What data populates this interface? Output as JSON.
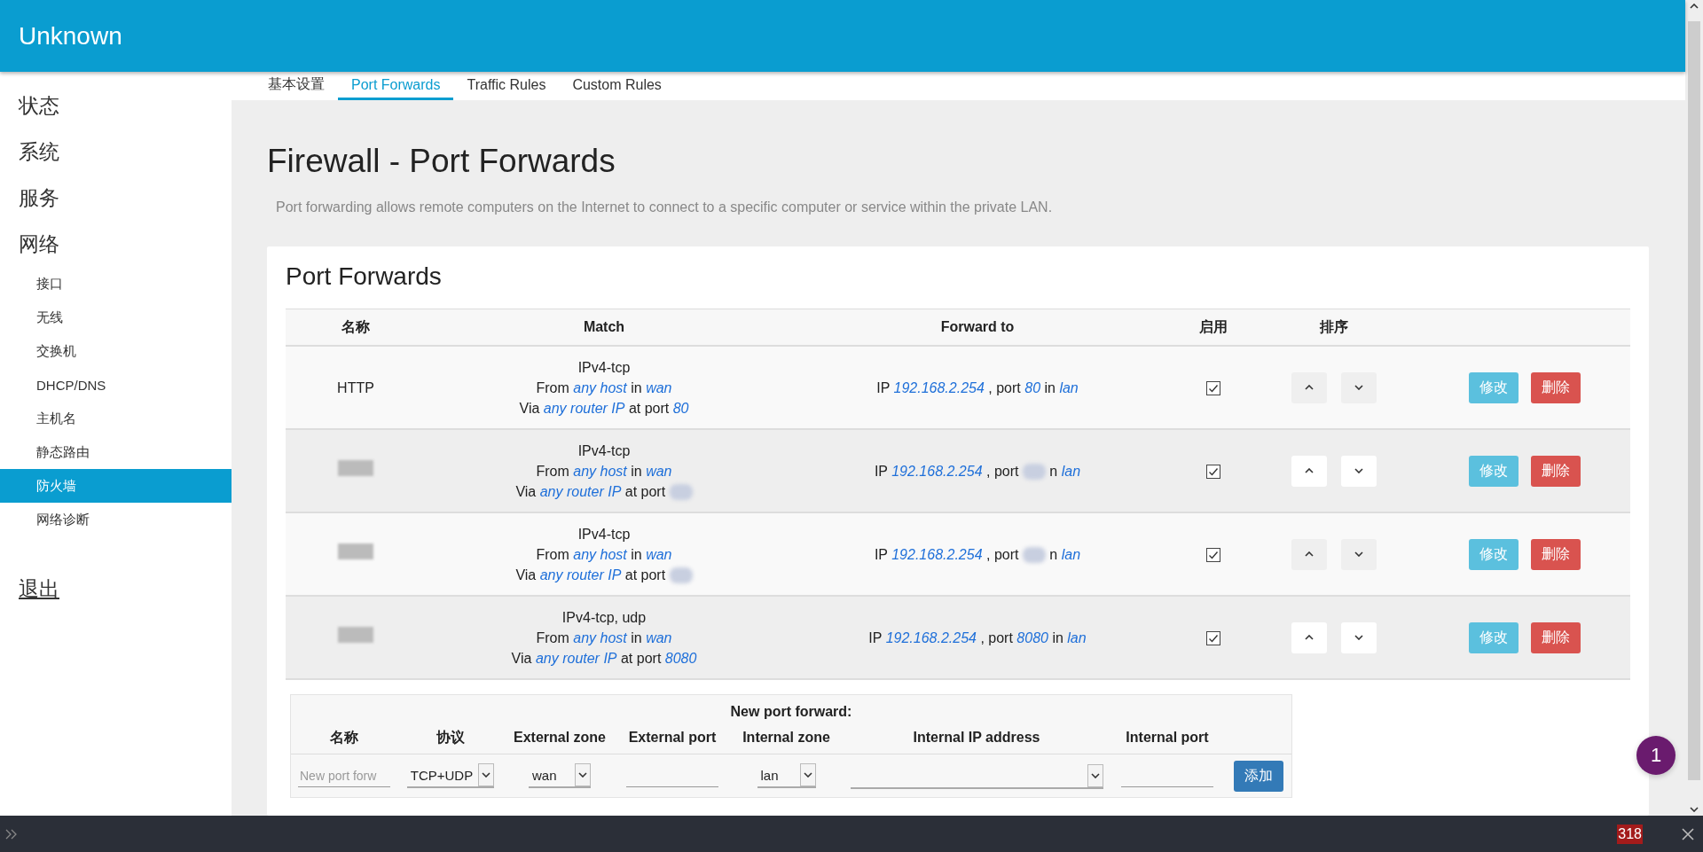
{
  "header": {
    "title": "Unknown"
  },
  "sidebar": {
    "items": [
      {
        "label": "状态",
        "selected": false
      },
      {
        "label": "系统",
        "selected": false
      },
      {
        "label": "服务",
        "selected": false
      },
      {
        "label": "网络",
        "selected": false,
        "children": [
          {
            "label": "接口",
            "selected": false
          },
          {
            "label": "无线",
            "selected": false
          },
          {
            "label": "交换机",
            "selected": false
          },
          {
            "label": "DHCP/DNS",
            "selected": false
          },
          {
            "label": "主机名",
            "selected": false
          },
          {
            "label": "静态路由",
            "selected": false
          },
          {
            "label": "防火墙",
            "selected": true
          },
          {
            "label": "网络诊断",
            "selected": false
          }
        ]
      }
    ],
    "logout": "退出"
  },
  "tabs": [
    {
      "label": "基本设置",
      "selected": false
    },
    {
      "label": "Port Forwards",
      "selected": true
    },
    {
      "label": "Traffic Rules",
      "selected": false
    },
    {
      "label": "Custom Rules",
      "selected": false
    }
  ],
  "page": {
    "title": "Firewall - Port Forwards",
    "description": "Port forwarding allows remote computers on the Internet to connect to a specific computer or service within the private LAN."
  },
  "section": {
    "title": "Port Forwards",
    "columns": [
      "名称",
      "Match",
      "Forward to",
      "启用",
      "排序"
    ],
    "rows": [
      {
        "name": {
          "kind": "text",
          "text": "HTTP"
        },
        "match": [
          [
            {
              "kind": "text",
              "text": "IPv4-tcp"
            }
          ],
          [
            {
              "kind": "text",
              "text": "From"
            },
            {
              "kind": "link",
              "text": "any host"
            },
            {
              "kind": "text",
              "text": "in"
            },
            {
              "kind": "link",
              "text": "wan"
            }
          ],
          [
            {
              "kind": "text",
              "text": "Via"
            },
            {
              "kind": "link",
              "text": "any router IP"
            },
            {
              "kind": "text",
              "text": "at port"
            },
            {
              "kind": "link",
              "text": "80"
            }
          ]
        ],
        "forward": [
          {
            "kind": "text",
            "text": "IP"
          },
          {
            "kind": "link",
            "text": "192.168.2.254"
          },
          {
            "kind": "text",
            "text": ", port"
          },
          {
            "kind": "link",
            "text": "80"
          },
          {
            "kind": "text",
            "text": "in"
          },
          {
            "kind": "link",
            "text": "lan"
          }
        ],
        "enabled": true,
        "edit": "修改",
        "delete": "删除"
      },
      {
        "name": {
          "kind": "redacted"
        },
        "match": [
          [
            {
              "kind": "text",
              "text": "IPv4-tcp"
            }
          ],
          [
            {
              "kind": "text",
              "text": "From"
            },
            {
              "kind": "link",
              "text": "any host"
            },
            {
              "kind": "text",
              "text": "in"
            },
            {
              "kind": "link",
              "text": "wan"
            }
          ],
          [
            {
              "kind": "text",
              "text": "Via"
            },
            {
              "kind": "link",
              "text": "any router IP"
            },
            {
              "kind": "text",
              "text": "at port"
            },
            {
              "kind": "redacted"
            }
          ]
        ],
        "forward": [
          {
            "kind": "text",
            "text": "IP"
          },
          {
            "kind": "link",
            "text": "192.168.2.254"
          },
          {
            "kind": "text",
            "text": ", port"
          },
          {
            "kind": "redacted"
          },
          {
            "kind": "text",
            "text": "n"
          },
          {
            "kind": "link",
            "text": "lan"
          }
        ],
        "enabled": true,
        "edit": "修改",
        "delete": "删除"
      },
      {
        "name": {
          "kind": "redacted"
        },
        "match": [
          [
            {
              "kind": "text",
              "text": "IPv4-tcp"
            }
          ],
          [
            {
              "kind": "text",
              "text": "From"
            },
            {
              "kind": "link",
              "text": "any host"
            },
            {
              "kind": "text",
              "text": "in"
            },
            {
              "kind": "link",
              "text": "wan"
            }
          ],
          [
            {
              "kind": "text",
              "text": "Via"
            },
            {
              "kind": "link",
              "text": "any router IP"
            },
            {
              "kind": "text",
              "text": "at port"
            },
            {
              "kind": "redacted"
            }
          ]
        ],
        "forward": [
          {
            "kind": "text",
            "text": "IP"
          },
          {
            "kind": "link",
            "text": "192.168.2.254"
          },
          {
            "kind": "text",
            "text": ", port"
          },
          {
            "kind": "redacted"
          },
          {
            "kind": "text",
            "text": "n"
          },
          {
            "kind": "link",
            "text": "lan"
          }
        ],
        "enabled": true,
        "edit": "修改",
        "delete": "删除"
      },
      {
        "name": {
          "kind": "redacted"
        },
        "match": [
          [
            {
              "kind": "text",
              "text": "IPv4-tcp, udp"
            }
          ],
          [
            {
              "kind": "text",
              "text": "From"
            },
            {
              "kind": "link",
              "text": "any host"
            },
            {
              "kind": "text",
              "text": "in"
            },
            {
              "kind": "link",
              "text": "wan"
            }
          ],
          [
            {
              "kind": "text",
              "text": "Via"
            },
            {
              "kind": "link",
              "text": "any router IP"
            },
            {
              "kind": "text",
              "text": "at port"
            },
            {
              "kind": "link",
              "text": "8080"
            }
          ]
        ],
        "forward": [
          {
            "kind": "text",
            "text": "IP"
          },
          {
            "kind": "link",
            "text": "192.168.2.254"
          },
          {
            "kind": "text",
            "text": ", port"
          },
          {
            "kind": "link",
            "text": "8080"
          },
          {
            "kind": "text",
            "text": "in"
          },
          {
            "kind": "link",
            "text": "lan"
          }
        ],
        "enabled": true,
        "edit": "修改",
        "delete": "删除"
      }
    ]
  },
  "new_forward": {
    "title": "New port forward:",
    "columns": [
      "名称",
      "协议",
      "External zone",
      "External port",
      "Internal zone",
      "Internal IP address",
      "Internal port"
    ],
    "fields": [
      {
        "kind": "input",
        "placeholder": "New port forw"
      },
      {
        "kind": "select",
        "value": "TCP+UDP"
      },
      {
        "kind": "select",
        "value": "wan"
      },
      {
        "kind": "input"
      },
      {
        "kind": "select",
        "value": "lan"
      },
      {
        "kind": "select"
      },
      {
        "kind": "input"
      }
    ],
    "add": "添加"
  },
  "notification_badge": "1",
  "bottom_bar": {
    "count": "318"
  }
}
